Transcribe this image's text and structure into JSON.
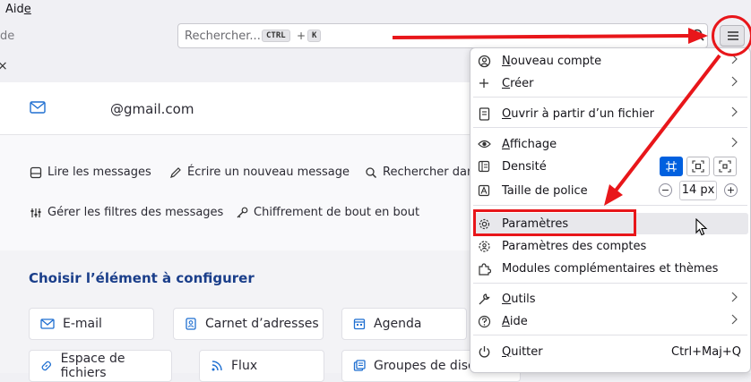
{
  "menubar": {
    "aide_prefix": "Aid",
    "aide_accel": "e"
  },
  "toolbar": {
    "left_text": "de",
    "search_placeholder": "Rechercher...",
    "kbd_ctrl": "CTRL",
    "kbd_plus": "+",
    "kbd_k": "K"
  },
  "tab": {
    "close": "×"
  },
  "account": {
    "email": "@gmail.com"
  },
  "actions": {
    "read": "Lire les messages",
    "write": "Écrire un nouveau message",
    "search": "Rechercher dans",
    "filters": "Gérer les filtres des messages",
    "encrypt": "Chiffrement de bout en bout"
  },
  "configure": {
    "title": "Choisir l’élément à configurer",
    "cards": {
      "email": "E-mail",
      "address": "Carnet d’adresses",
      "agenda": "Agenda",
      "files": "Espace de fichiers",
      "feeds": "Flux",
      "groups": "Groupes de discussion"
    }
  },
  "app_menu": {
    "nouveau_compte": {
      "accel": "N",
      "rest": "ouveau compte"
    },
    "creer": {
      "accel": "C",
      "rest": "réer"
    },
    "ouvrir": {
      "accel": "O",
      "rest": "uvrir à partir d’un fichier"
    },
    "affichage": {
      "accel": "A",
      "rest": "ffichage"
    },
    "densite": "Densité",
    "taille": "Taille de police",
    "font_size_value": "14 px",
    "font_minus": "−",
    "font_plus": "+",
    "parametres": "Paramètres",
    "parametres_comptes": "Paramètres des comptes",
    "modules": "Modules complémentaires et thèmes",
    "outils": {
      "accel": "O",
      "rest": "utils"
    },
    "aide": {
      "accel": "A",
      "rest": "ide"
    },
    "quitter": {
      "accel": "Q",
      "rest": "uitter"
    },
    "quitter_shortcut": "Ctrl+Maj+Q"
  },
  "colors": {
    "annotation": "#e8161a",
    "accent": "#0060df",
    "section_title": "#1a3e8a"
  },
  "icons": [
    "search-icon",
    "menu-icon",
    "mail-icon",
    "read-icon",
    "pencil-icon",
    "magnifier-icon",
    "filters-icon",
    "key-icon",
    "address-book-icon",
    "calendar-icon",
    "link-icon",
    "rss-icon",
    "newsgroup-icon",
    "new-account-icon",
    "plus-icon",
    "file-icon",
    "eye-icon",
    "density-icon",
    "font-icon",
    "gear-icon",
    "account-settings-icon",
    "puzzle-icon",
    "wrench-icon",
    "help-icon",
    "power-icon",
    "cursor-icon"
  ]
}
